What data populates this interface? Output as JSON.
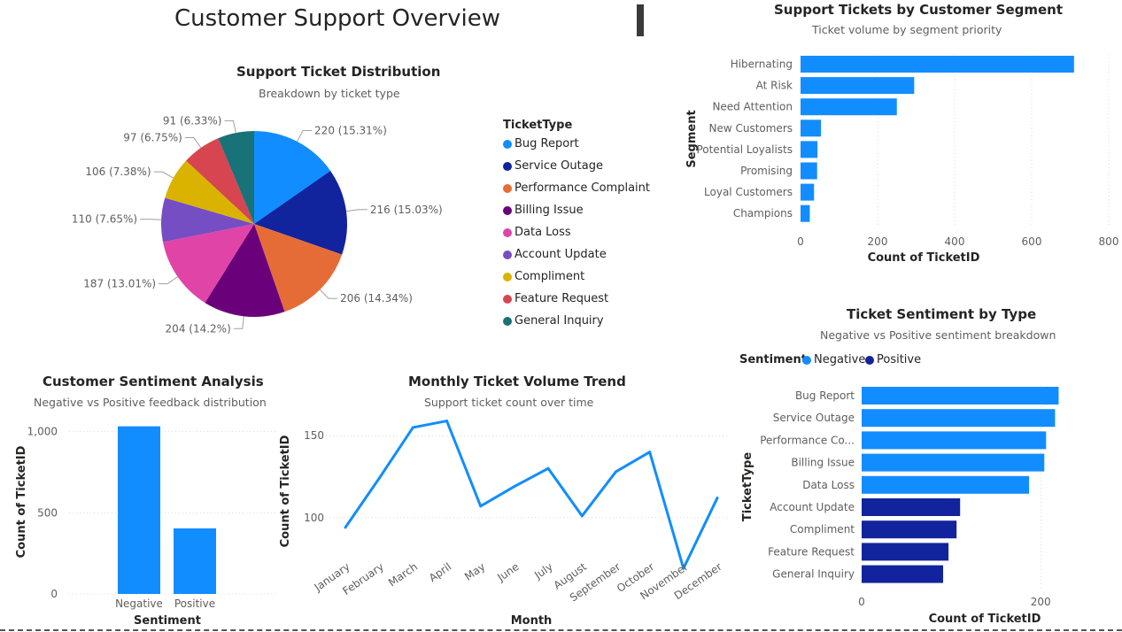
{
  "page": {
    "title": "Customer Support Overview"
  },
  "chart_data": [
    {
      "id": "pie",
      "type": "pie",
      "title": "Support Ticket Distribution",
      "subtitle": "Breakdown by ticket type",
      "legend_title": "TicketType",
      "legend_position": "right",
      "slices": [
        {
          "name": "Bug Report",
          "value": 220,
          "label": "220 (15.31%)",
          "color": "#118DFF"
        },
        {
          "name": "Service Outage",
          "value": 216,
          "label": "216 (15.03%)",
          "color": "#12239E"
        },
        {
          "name": "Performance Complaint",
          "value": 206,
          "label": "206 (14.34%)",
          "color": "#E66C37"
        },
        {
          "name": "Billing Issue",
          "value": 204,
          "label": "204 (14.2%)",
          "color": "#6B007B"
        },
        {
          "name": "Data Loss",
          "value": 187,
          "label": "187 (13.01%)",
          "color": "#E044A7"
        },
        {
          "name": "Account Update",
          "value": 110,
          "label": "110 (7.65%)",
          "color": "#744EC2"
        },
        {
          "name": "Compliment",
          "value": 106,
          "label": "106 (7.38%)",
          "color": "#D9B300"
        },
        {
          "name": "Feature Request",
          "value": 97,
          "label": "97 (6.75%)",
          "color": "#D64550"
        },
        {
          "name": "General Inquiry",
          "value": 91,
          "label": "91 (6.33%)",
          "color": "#197278"
        }
      ]
    },
    {
      "id": "segment",
      "type": "bar",
      "orientation": "horizontal",
      "title": "Support Tickets by Customer Segment",
      "subtitle": "Ticket volume by segment priority",
      "xlabel": "Count of TicketID",
      "ylabel": "Segment",
      "xlim": [
        0,
        800
      ],
      "xticks": [
        0,
        200,
        400,
        600,
        800
      ],
      "xtick_labels": [
        "0",
        "200",
        "400",
        "600",
        "800"
      ],
      "grid": true,
      "color": "#118DFF",
      "categories": [
        "Hibernating",
        "At Risk",
        "Need Attention",
        "New Customers",
        "Potential Loyalists",
        "Promising",
        "Loyal Customers",
        "Champions"
      ],
      "values": [
        710,
        295,
        250,
        53,
        44,
        43,
        35,
        24
      ]
    },
    {
      "id": "sentiment",
      "type": "bar",
      "orientation": "vertical",
      "title": "Customer Sentiment Analysis",
      "subtitle": "Negative vs Positive feedback distribution",
      "xlabel": "Sentiment",
      "ylabel": "Count of TicketID",
      "ylim": [
        0,
        1200
      ],
      "yticks": [
        0,
        500,
        1000
      ],
      "ytick_labels": [
        "0",
        "500",
        "1,000"
      ],
      "grid": true,
      "color": "#118DFF",
      "categories": [
        "Negative",
        "Positive"
      ],
      "values": [
        1033,
        404
      ]
    },
    {
      "id": "monthly",
      "type": "line",
      "title": "Monthly Ticket Volume Trend",
      "subtitle": "Support ticket count over time",
      "xlabel": "Month",
      "ylabel": "Count of TicketID",
      "ylim": [
        68,
        162
      ],
      "yticks": [
        100,
        150
      ],
      "ytick_labels": [
        "100",
        "150"
      ],
      "grid": true,
      "color": "#118DFF",
      "categories": [
        "January",
        "February",
        "March",
        "April",
        "May",
        "June",
        "July",
        "August",
        "September",
        "October",
        "November",
        "December"
      ],
      "values": [
        94,
        124,
        155,
        159,
        107,
        119,
        130,
        101,
        128,
        140,
        69,
        112
      ]
    },
    {
      "id": "sentiment_type",
      "type": "bar",
      "orientation": "horizontal",
      "title": "Ticket Sentiment by Type",
      "subtitle": "Negative vs Positive sentiment breakdown",
      "legend_title": "Sentiment",
      "legend_position": "top-left",
      "xlabel": "Count of TicketID",
      "ylabel": "TicketType",
      "xlim": [
        0,
        270
      ],
      "xticks": [
        0,
        200
      ],
      "xtick_labels": [
        "0",
        "200"
      ],
      "grid": true,
      "series": [
        {
          "name": "Negative",
          "color": "#118DFF"
        },
        {
          "name": "Positive",
          "color": "#12239E"
        }
      ],
      "categories": [
        "Bug Report",
        "Service Outage",
        "Performance Co...",
        "Billing Issue",
        "Data Loss",
        "Account Update",
        "Compliment",
        "Feature Request",
        "General Inquiry"
      ],
      "values": [
        220,
        216,
        206,
        204,
        187,
        110,
        106,
        97,
        91
      ],
      "value_series": [
        "Negative",
        "Negative",
        "Negative",
        "Negative",
        "Negative",
        "Positive",
        "Positive",
        "Positive",
        "Positive"
      ]
    }
  ]
}
